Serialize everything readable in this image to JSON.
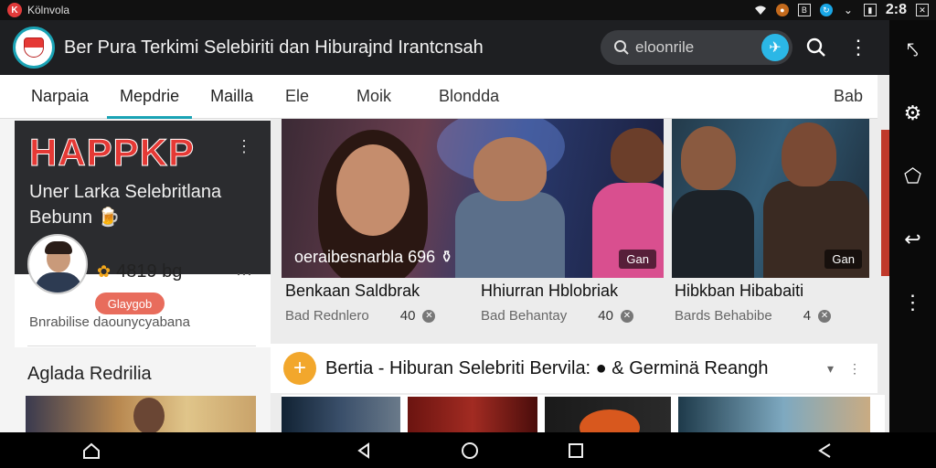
{
  "status": {
    "app_badge": "K",
    "app_name": "Kölnvola",
    "time": "2:8",
    "icons": [
      "wifi-icon",
      "notification-icon",
      "signal-icon",
      "sync-icon",
      "battery-icon",
      "close-box-icon"
    ]
  },
  "appbar": {
    "title": "Ber Pura Terkimi Selebiriti dan Hiburajnd Irantcnsah",
    "search_text": "eloonrile"
  },
  "left": {
    "tabs": [
      {
        "label": "Narpaia",
        "active": false
      },
      {
        "label": "Mepdrie",
        "active": true
      },
      {
        "label": "Mailla",
        "active": false
      }
    ],
    "promo_headline": "HAPPKP",
    "promo_subtitle_line1": "Uner Larka Selebritlana",
    "promo_subtitle_line2": "Bebunn 🍺",
    "stat_value": "4819 bg",
    "pill_label": "Glaygob",
    "caption": "Bnrabilise daounycyabana",
    "section_title": "Aglada Redrilia"
  },
  "main": {
    "tabs": [
      "Ele",
      "Moik",
      "Blondda",
      "Bab"
    ],
    "features": [
      {
        "caption": "oeraibesnarbla 696 ⚱",
        "badge": "Gan"
      },
      {
        "caption": "",
        "badge": "Gan"
      }
    ],
    "articles": [
      {
        "title": "Benkaan Saldbrak",
        "source": "Bad Rednlero",
        "count": "40"
      },
      {
        "title": "Hhiurran Hblobriak",
        "source": "Bad Behantay",
        "count": "40"
      },
      {
        "title": "Hibkban Hibabaiti",
        "source": "Bards Behabibe",
        "count": "4"
      }
    ],
    "section_title": "Bertia - Hiburan Selebriti Bervila: ● & Germinä Reangh"
  },
  "colors": {
    "accent": "#1aa3b5",
    "search_go": "#2bb7e6",
    "promo_red": "#e53935",
    "pill": "#e86c5c",
    "plus": "#f2a72c"
  }
}
